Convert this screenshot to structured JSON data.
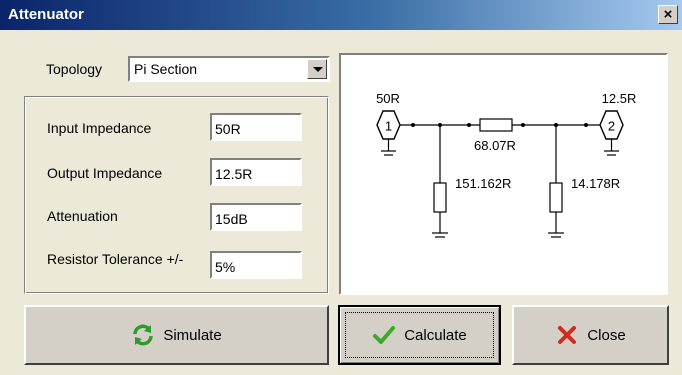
{
  "window": {
    "title": "Attenuator",
    "close_glyph": "×"
  },
  "topology": {
    "label": "Topology",
    "selected": "Pi Section"
  },
  "fields": {
    "input_impedance": {
      "label": "Input Impedance",
      "value": "50R"
    },
    "output_impedance": {
      "label": "Output Impedance",
      "value": "12.5R"
    },
    "attenuation": {
      "label": "Attenuation",
      "value": "15dB"
    },
    "tolerance": {
      "label": "Resistor Tolerance +/-",
      "value": "5%"
    }
  },
  "diagram": {
    "input_label": "50R",
    "output_label": "12.5R",
    "port_in": "1",
    "port_out": "2",
    "series_resistor": "68.07R",
    "shunt_in_resistor": "151.162R",
    "shunt_out_resistor": "14.178R"
  },
  "buttons": {
    "simulate": {
      "label": "Simulate",
      "icon": "refresh-icon"
    },
    "calculate": {
      "label": "Calculate",
      "icon": "checkmark-icon"
    },
    "close": {
      "label": "Close",
      "icon": "close-x-icon"
    }
  },
  "colors": {
    "title_start": "#0a246a",
    "title_end": "#a6caf0",
    "check_green": "#3cab2a",
    "close_red": "#d22a1e"
  }
}
